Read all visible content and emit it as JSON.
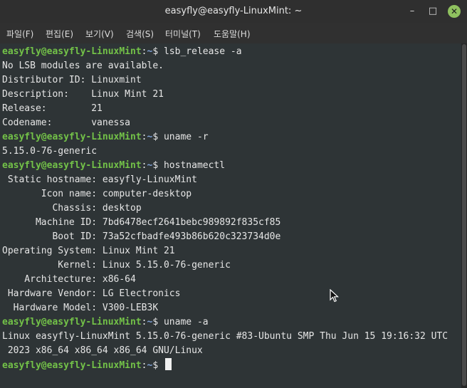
{
  "window": {
    "title": "easyfly@easyfly-LinuxMint: ~"
  },
  "titlebar_buttons": {
    "min": "–",
    "max": "□",
    "close": "✕"
  },
  "menu": [
    "파일(F)",
    "편집(E)",
    "보기(V)",
    "검색(S)",
    "터미널(T)",
    "도움말(H)"
  ],
  "prompt": {
    "user": "easyfly@easyfly-LinuxMint",
    "sep": ":",
    "path": "~",
    "symbol": "$ "
  },
  "lines": [
    {
      "cmd": "lsb_release -a"
    },
    {
      "text": "No LSB modules are available."
    },
    {
      "text": "Distributor ID:\tLinuxmint"
    },
    {
      "text": "Description:\tLinux Mint 21"
    },
    {
      "text": "Release:\t21"
    },
    {
      "text": "Codename:\tvanessa"
    },
    {
      "cmd": "uname -r"
    },
    {
      "text": "5.15.0-76-generic"
    },
    {
      "cmd": "hostnamectl"
    },
    {
      "text": " Static hostname: easyfly-LinuxMint"
    },
    {
      "text": "       Icon name: computer-desktop"
    },
    {
      "text": "         Chassis: desktop"
    },
    {
      "text": "      Machine ID: 7bd6478ecf2641bebc989892f835cf85"
    },
    {
      "text": "         Boot ID: 73a52cfbadfe493b86b620c323734d0e"
    },
    {
      "text": "Operating System: Linux Mint 21"
    },
    {
      "text": "          Kernel: Linux 5.15.0-76-generic"
    },
    {
      "text": "    Architecture: x86-64"
    },
    {
      "text": " Hardware Vendor: LG Electronics"
    },
    {
      "text": "  Hardware Model: V300-LEB3K"
    },
    {
      "cmd": "uname -a"
    },
    {
      "text": "Linux easyfly-LinuxMint 5.15.0-76-generic #83-Ubuntu SMP Thu Jun 15 19:16:32 UTC"
    },
    {
      "text": " 2023 x86_64 x86_64 x86_64 GNU/Linux"
    },
    {
      "cmd": ""
    }
  ],
  "colors": {
    "user": "#73c248",
    "path": "#7fa1d6",
    "text": "#e6e6e6",
    "background": "#2e3436"
  }
}
